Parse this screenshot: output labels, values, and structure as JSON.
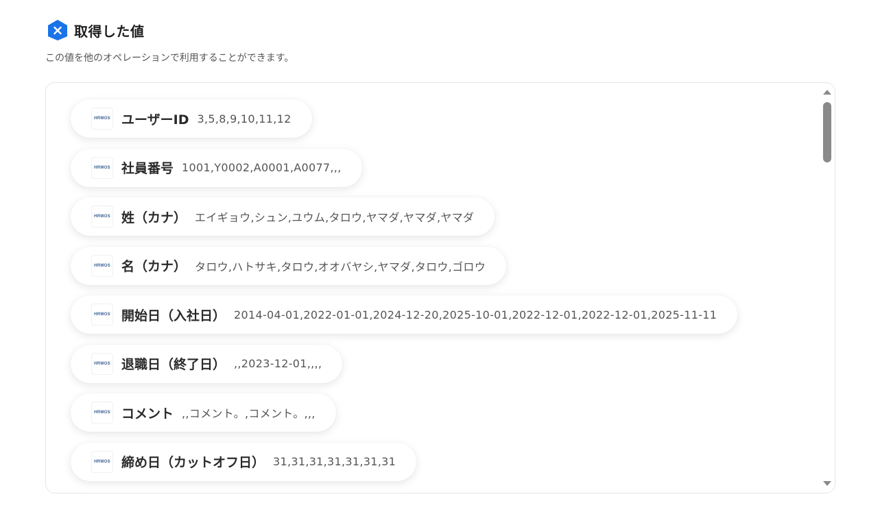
{
  "header": {
    "title": "取得した値",
    "subtitle": "この値を他のオペレーションで利用することができます。",
    "icon": "yoom-hex-icon",
    "accent": "#1a73e8"
  },
  "items": [
    {
      "logo": "HRMOS",
      "label": "ユーザーID",
      "value": "3,5,8,9,10,11,12"
    },
    {
      "logo": "HRMOS",
      "label": "社員番号",
      "value": "1001,Y0002,A0001,A0077,,,"
    },
    {
      "logo": "HRMOS",
      "label": "姓（カナ）",
      "value": "エイギョウ,シュン,ユウム,タロウ,ヤマダ,ヤマダ,ヤマダ"
    },
    {
      "logo": "HRMOS",
      "label": "名（カナ）",
      "value": "タロウ,ハトサキ,タロウ,オオバヤシ,ヤマダ,タロウ,ゴロウ"
    },
    {
      "logo": "HRMOS",
      "label": "開始日（入社日）",
      "value": "2014-04-01,2022-01-01,2024-12-20,2025-10-01,2022-12-01,2022-12-01,2025-11-11"
    },
    {
      "logo": "HRMOS",
      "label": "退職日（終了日）",
      "value": ",,2023-12-01,,,,"
    },
    {
      "logo": "HRMOS",
      "label": "コメント",
      "value": ",,コメント。,コメント。,,,"
    },
    {
      "logo": "HRMOS",
      "label": "締め日（カットオフ日）",
      "value": "31,31,31,31,31,31,31"
    }
  ]
}
